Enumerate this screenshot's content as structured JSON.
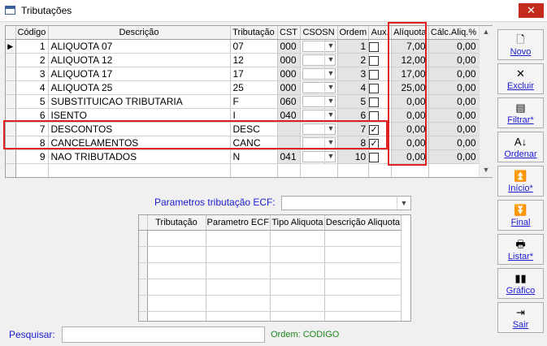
{
  "window": {
    "title": "Tributações",
    "close_label": "✕"
  },
  "grid": {
    "columns": [
      "Código",
      "Descrição",
      "Tributação",
      "CST",
      "CSOSN",
      "Ordem",
      "Aux.",
      "Alíquota",
      "Cálc.Aliq.%"
    ],
    "rows": [
      {
        "codigo": "1",
        "descricao": "ALIQUOTA 07",
        "tributacao": "07",
        "cst": "000",
        "ordem": "1",
        "aux": false,
        "aliquota": "7,00",
        "calc": "0,00",
        "indicator": "▶"
      },
      {
        "codigo": "2",
        "descricao": "ALIQUOTA 12",
        "tributacao": "12",
        "cst": "000",
        "ordem": "2",
        "aux": false,
        "aliquota": "12,00",
        "calc": "0,00",
        "indicator": ""
      },
      {
        "codigo": "3",
        "descricao": "ALIQUOTA 17",
        "tributacao": "17",
        "cst": "000",
        "ordem": "3",
        "aux": false,
        "aliquota": "17,00",
        "calc": "0,00",
        "indicator": ""
      },
      {
        "codigo": "4",
        "descricao": "ALIQUOTA 25",
        "tributacao": "25",
        "cst": "000",
        "ordem": "4",
        "aux": false,
        "aliquota": "25,00",
        "calc": "0,00",
        "indicator": ""
      },
      {
        "codigo": "5",
        "descricao": "SUBSTITUICAO TRIBUTARIA",
        "tributacao": "F",
        "cst": "060",
        "ordem": "5",
        "aux": false,
        "aliquota": "0,00",
        "calc": "0,00",
        "indicator": ""
      },
      {
        "codigo": "6",
        "descricao": "ISENTO",
        "tributacao": "I",
        "cst": "040",
        "ordem": "6",
        "aux": false,
        "aliquota": "0,00",
        "calc": "0,00",
        "indicator": ""
      },
      {
        "codigo": "7",
        "descricao": "DESCONTOS",
        "tributacao": "DESC",
        "cst": "",
        "ordem": "7",
        "aux": true,
        "aliquota": "0,00",
        "calc": "0,00",
        "indicator": ""
      },
      {
        "codigo": "8",
        "descricao": "CANCELAMENTOS",
        "tributacao": "CANC",
        "cst": "",
        "ordem": "8",
        "aux": true,
        "aliquota": "0,00",
        "calc": "0,00",
        "indicator": ""
      },
      {
        "codigo": "9",
        "descricao": "NAO TRIBUTADOS",
        "tributacao": "N",
        "cst": "041",
        "ordem": "10",
        "aux": false,
        "aliquota": "0,00",
        "calc": "0,00",
        "indicator": ""
      }
    ]
  },
  "ecf": {
    "label": "Parametros tributação ECF:",
    "selected": "",
    "columns": [
      "Tributação",
      "Parametro ECF",
      "Tipo Aliquota",
      "Descrição Aliquota"
    ]
  },
  "search": {
    "label": "Pesquisar:",
    "value": ""
  },
  "order_label": "Ordem: CODIGO",
  "toolbar": [
    {
      "id": "novo",
      "label": "Novo",
      "icon": "new-document-icon",
      "glyph": "🗋"
    },
    {
      "id": "excluir",
      "label": "Excluir",
      "icon": "delete-x-icon",
      "glyph": "✕"
    },
    {
      "id": "filtrar",
      "label": "Filtrar*",
      "icon": "filter-icon",
      "glyph": "▤"
    },
    {
      "id": "ordenar",
      "label": "Ordenar",
      "icon": "sort-az-icon",
      "glyph": "A↓"
    },
    {
      "id": "inicio",
      "label": "Início*",
      "icon": "first-record-icon",
      "glyph": "⏫"
    },
    {
      "id": "final",
      "label": "Final",
      "icon": "last-record-icon",
      "glyph": "⏬"
    },
    {
      "id": "listar",
      "label": "Listar*",
      "icon": "printer-icon",
      "glyph": "🖶"
    },
    {
      "id": "grafico",
      "label": "Gráfico",
      "icon": "bar-chart-icon",
      "glyph": "▮▮"
    },
    {
      "id": "sair",
      "label": "Sair",
      "icon": "exit-door-icon",
      "glyph": "⇥"
    }
  ],
  "colors": {
    "highlight_box": "#e02020",
    "label_blue": "#1a1ad0",
    "order_green": "#1a8a1a",
    "close_red": "#c42b1c"
  }
}
